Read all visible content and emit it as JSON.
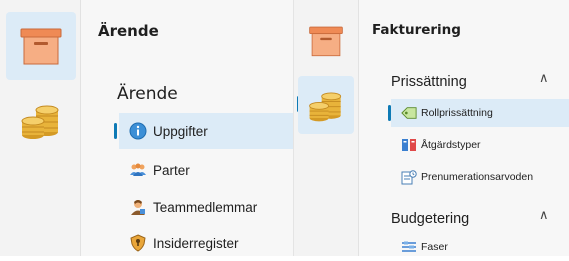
{
  "left_panel": {
    "title": "Ärende",
    "group_title": "Ärende",
    "items": [
      {
        "label": "Uppgifter",
        "selected": true
      },
      {
        "label": "Parter"
      },
      {
        "label": "Teammedlemmar"
      },
      {
        "label": "Insiderregister"
      }
    ]
  },
  "right_panel": {
    "title": "Fakturering",
    "sections": [
      {
        "title": "Prissättning",
        "expanded": true,
        "items": [
          {
            "label": "Rollprissättning",
            "selected": true
          },
          {
            "label": "Åtgärdstyper"
          },
          {
            "label": "Prenumerationsarvoden"
          }
        ]
      },
      {
        "title": "Budgetering",
        "expanded": true,
        "items": [
          {
            "label": "Faser"
          }
        ]
      }
    ]
  },
  "colors": {
    "accent": "#0e7ab5",
    "selected_bg": "#dcebf7",
    "box_orange": "#f29a6b",
    "coin_gold": "#e8b33a"
  },
  "icons": [
    "archive-box-icon",
    "coins-icon",
    "info-icon",
    "people-icon",
    "team-member-icon",
    "shield-icon",
    "tag-icon",
    "action-types-icon",
    "subscription-icon",
    "phases-icon",
    "chevron-up-icon"
  ]
}
